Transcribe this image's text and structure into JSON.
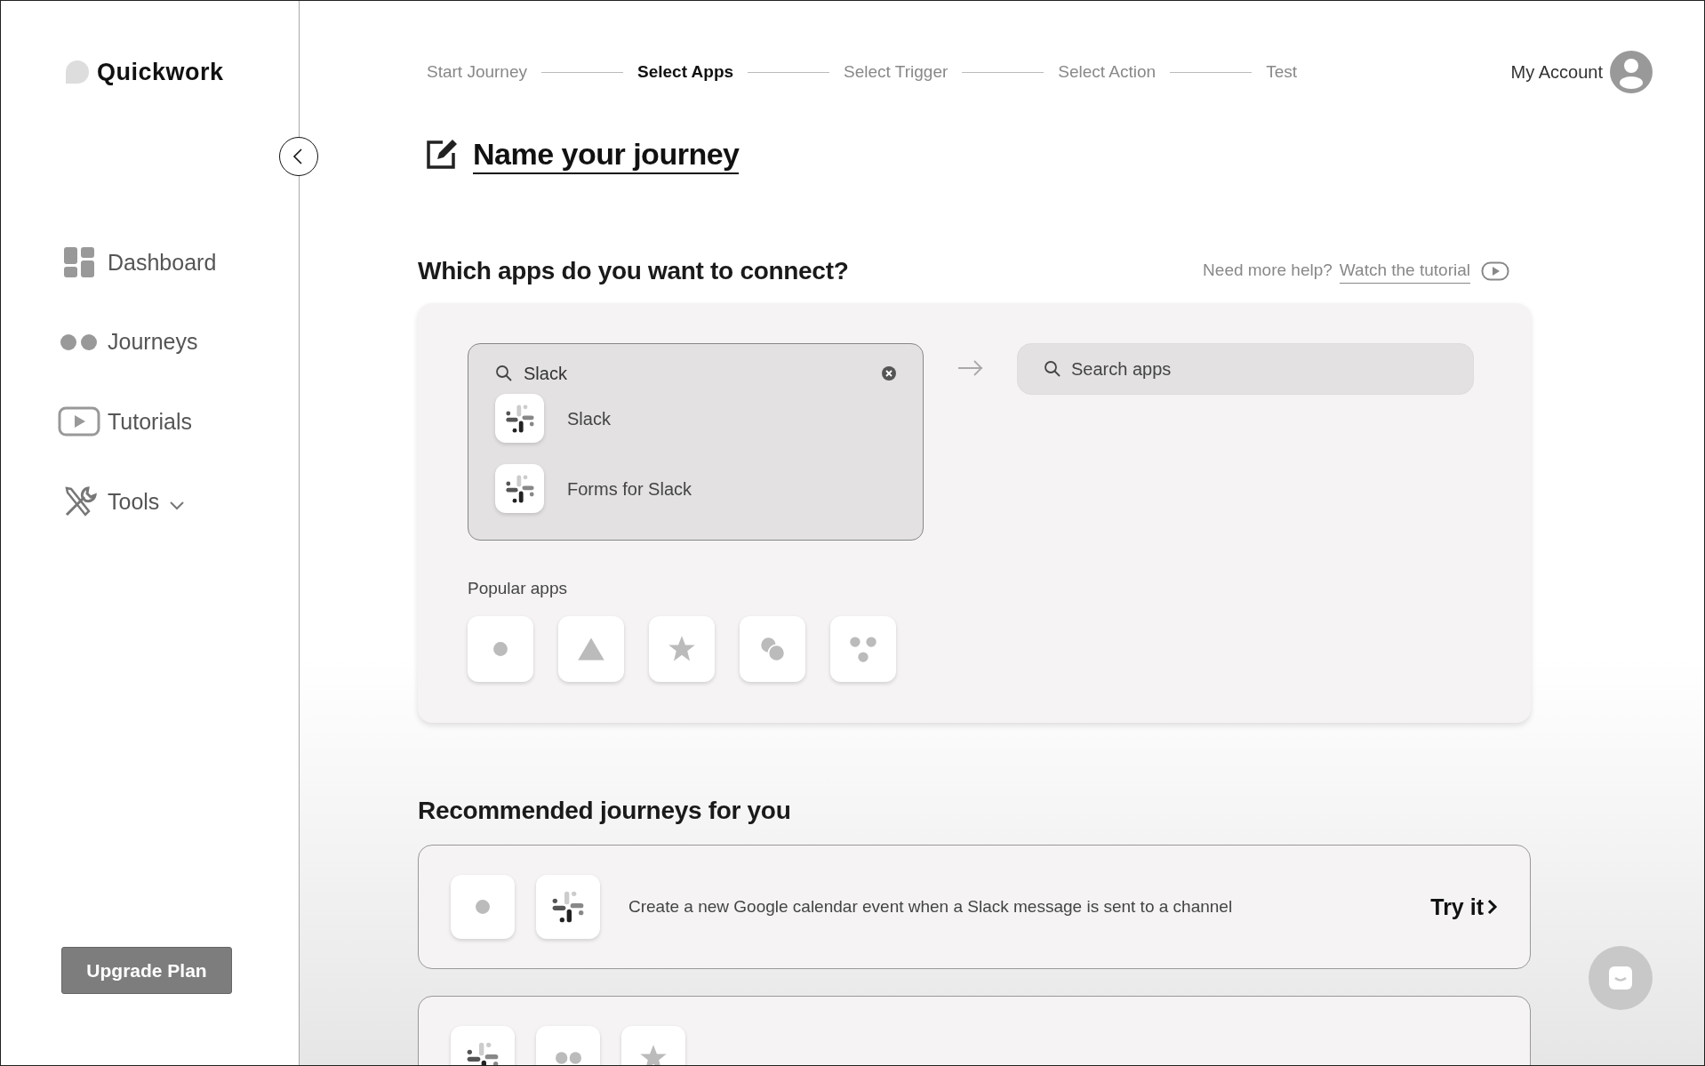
{
  "brand": {
    "name": "Quickwork"
  },
  "sidebar": {
    "items": [
      {
        "label": "Dashboard",
        "kind": "link"
      },
      {
        "label": "Journeys",
        "kind": "link"
      },
      {
        "label": "Tutorials",
        "kind": "link"
      },
      {
        "label": "Tools",
        "kind": "dropdown"
      }
    ],
    "upgrade_button": "Upgrade Plan"
  },
  "steps": [
    {
      "label": "Start Journey",
      "selected": false
    },
    {
      "label": "Select Apps",
      "selected": true
    },
    {
      "label": "Select Trigger",
      "selected": false
    },
    {
      "label": "Select Action",
      "selected": false
    },
    {
      "label": "Test",
      "selected": false
    }
  ],
  "account": {
    "label": "My Account"
  },
  "journey_title": "Name your journey",
  "connect": {
    "heading": "Which apps do you want to connect?",
    "help_text": "Need more help?",
    "help_link": "Watch the tutorial",
    "source_search": {
      "value": "Slack",
      "results": [
        {
          "name": "Slack",
          "kind": "slack"
        },
        {
          "name": "Forms for Slack",
          "kind": "slack"
        }
      ]
    },
    "target_search": {
      "placeholder": "Search apps"
    },
    "popular_label": "Popular apps",
    "popular_apps": [
      {
        "kind": "dot"
      },
      {
        "kind": "triangle"
      },
      {
        "kind": "star"
      },
      {
        "kind": "circles"
      },
      {
        "kind": "dots"
      }
    ]
  },
  "recommended": {
    "heading": "Recommended journeys for you",
    "journeys": [
      {
        "apps": [
          {
            "kind": "dot"
          },
          {
            "kind": "slack"
          }
        ],
        "description": "Create a new Google calendar event when a Slack message is sent to a channel",
        "action": "Try it"
      },
      {
        "apps": [
          {
            "kind": "slack"
          },
          {
            "kind": "pair"
          },
          {
            "kind": "star"
          }
        ]
      }
    ]
  }
}
